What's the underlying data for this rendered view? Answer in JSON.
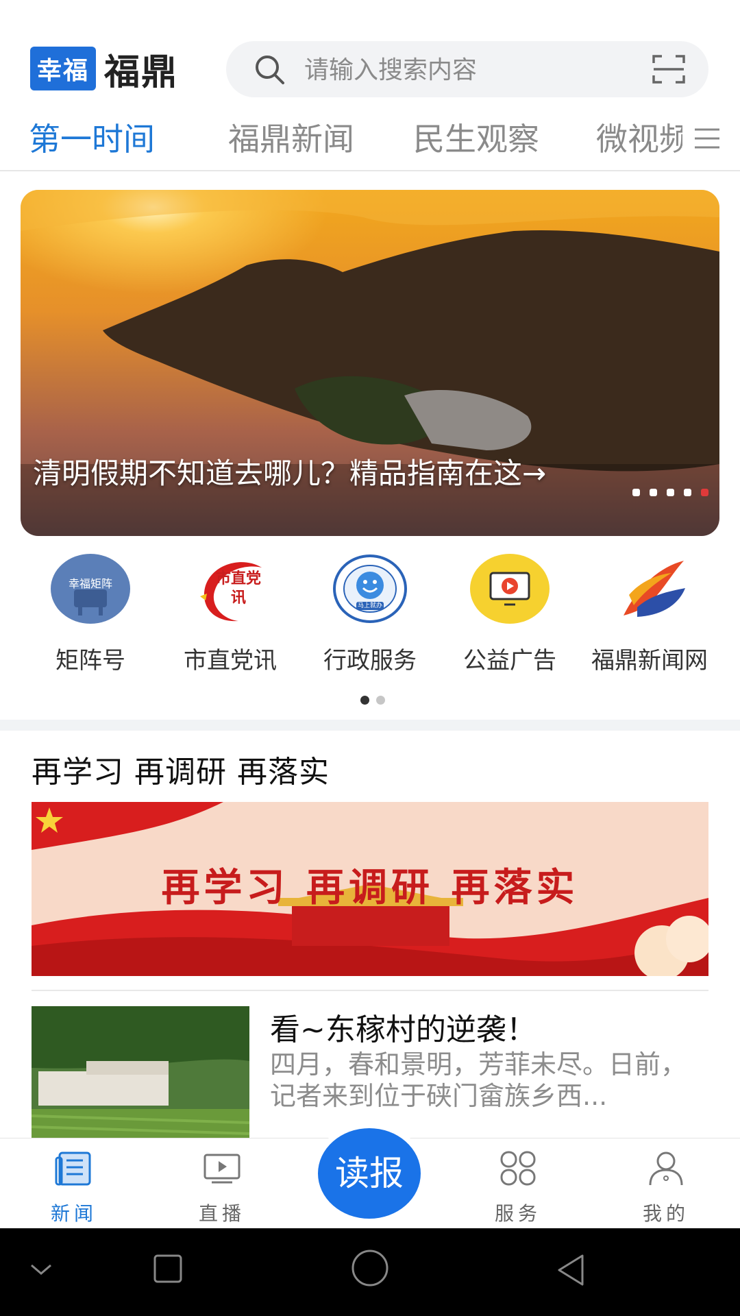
{
  "header": {
    "logo_box": "幸福",
    "logo_text": "福鼎",
    "search_placeholder": "请输入搜索内容"
  },
  "tabs": [
    {
      "label": "第一时间",
      "active": true
    },
    {
      "label": "福鼎新闻",
      "active": false
    },
    {
      "label": "民生观察",
      "active": false
    },
    {
      "label": "微视频",
      "active": false
    }
  ],
  "banner": {
    "title": "清明假期不知道去哪儿？精品指南在这→",
    "slide_count": 5,
    "active_slide": 5
  },
  "shortcuts": [
    {
      "label": "矩阵号",
      "icon_text": "幸福矩阵",
      "icon": "matrix-icon"
    },
    {
      "label": "市直党讯",
      "icon_text": "市直党讯",
      "icon": "party-news-icon"
    },
    {
      "label": "行政服务",
      "icon_text": "马上就办",
      "icon": "admin-service-icon"
    },
    {
      "label": "公益广告",
      "icon": "video-screen-icon"
    },
    {
      "label": "福鼎新闻网",
      "icon": "feather-logo-icon"
    }
  ],
  "shortcut_pages": {
    "count": 2,
    "active": 1
  },
  "section": {
    "title": "再学习 再调研 再落实",
    "banner_text": "再学习 再调研 再落实"
  },
  "news": [
    {
      "title": "看~东稼村的逆袭！",
      "desc": "四月，春和景明，芳菲未尽。日前，记者来到位于硖门畲族乡西..."
    }
  ],
  "bottom_nav": {
    "items": [
      {
        "label": "新闻",
        "active": true
      },
      {
        "label": "直播",
        "active": false
      },
      {
        "label": "服务",
        "active": false
      },
      {
        "label": "我的",
        "active": false
      }
    ],
    "read_button": "读报"
  },
  "colors": {
    "accent": "#1e78d6",
    "read_button": "#1a73e8",
    "banner_dot_active": "#e03a3a"
  }
}
